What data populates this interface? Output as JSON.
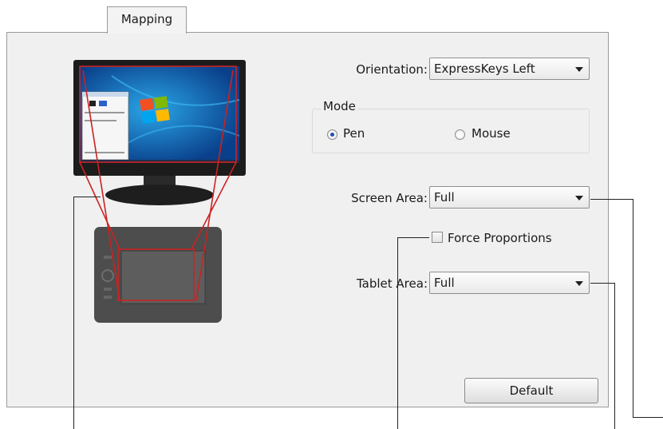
{
  "tabs": [
    {
      "label": "Mapping"
    }
  ],
  "orientation": {
    "label": "Orientation:",
    "value": "ExpressKeys Left"
  },
  "mode": {
    "title": "Mode",
    "options": [
      {
        "label": "Pen",
        "selected": true
      },
      {
        "label": "Mouse",
        "selected": false
      }
    ]
  },
  "screen_area": {
    "label": "Screen Area:",
    "value": "Full"
  },
  "force_proportions": {
    "label": "Force Proportions",
    "checked": false
  },
  "tablet_area": {
    "label": "Tablet Area:",
    "value": "Full"
  },
  "default_button": {
    "label": "Default"
  },
  "colors": {
    "mapping_lines": "#cc2222",
    "selected_radio": "#1f4fa8"
  }
}
